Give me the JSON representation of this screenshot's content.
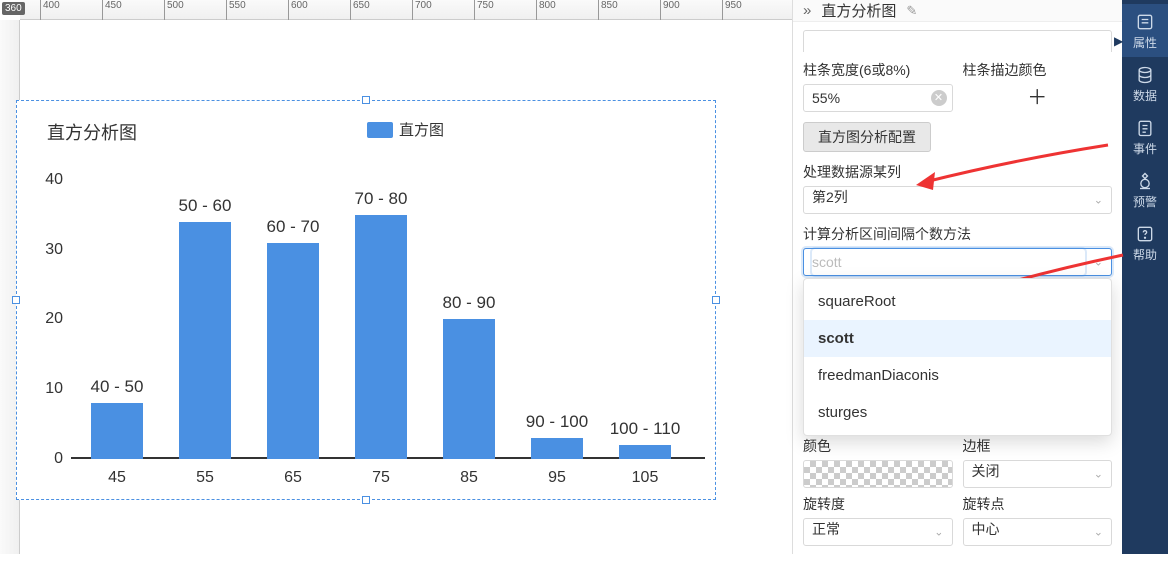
{
  "ruler_h": [
    "400",
    "450",
    "500",
    "550",
    "600",
    "650",
    "700",
    "750",
    "800",
    "850",
    "900",
    "950"
  ],
  "ruler_h_badge": "360",
  "panel": {
    "title": "直方分析图",
    "bar_width_label": "柱条宽度(6或8%)",
    "bar_width_value": "55%",
    "stroke_color_label": "柱条描边颜色",
    "config_btn": "直方图分析配置",
    "column_label": "处理数据源某列",
    "column_value": "第2列",
    "method_label": "计算分析区间间隔个数方法",
    "method_value": "scott",
    "method_options": [
      "squareRoot",
      "scott",
      "freedmanDiaconis",
      "sturges"
    ],
    "color_label": "颜色",
    "border_label": "边框",
    "border_value": "关闭",
    "rotate_label": "旋转度",
    "rotate_value": "正常",
    "rotate_point_label": "旋转点",
    "rotate_point_value": "中心"
  },
  "rail": {
    "items": [
      {
        "name": "properties",
        "label": "属性"
      },
      {
        "name": "data",
        "label": "数据"
      },
      {
        "name": "events",
        "label": "事件"
      },
      {
        "name": "alert",
        "label": "预警"
      },
      {
        "name": "help",
        "label": "帮助"
      }
    ]
  },
  "chart_data": {
    "type": "bar",
    "title": "直方分析图",
    "legend": "直方图",
    "categories": [
      "45",
      "55",
      "65",
      "75",
      "85",
      "95",
      "105"
    ],
    "bar_labels": [
      "40 - 50",
      "50 - 60",
      "60 - 70",
      "70 - 80",
      "80 - 90",
      "90 - 100",
      "100 - 110"
    ],
    "values": [
      8,
      34,
      31,
      35,
      20,
      3,
      2
    ],
    "y_ticks": [
      0,
      10,
      20,
      30,
      40
    ],
    "ylim": [
      0,
      42
    ],
    "xlabel": "",
    "ylabel": ""
  }
}
